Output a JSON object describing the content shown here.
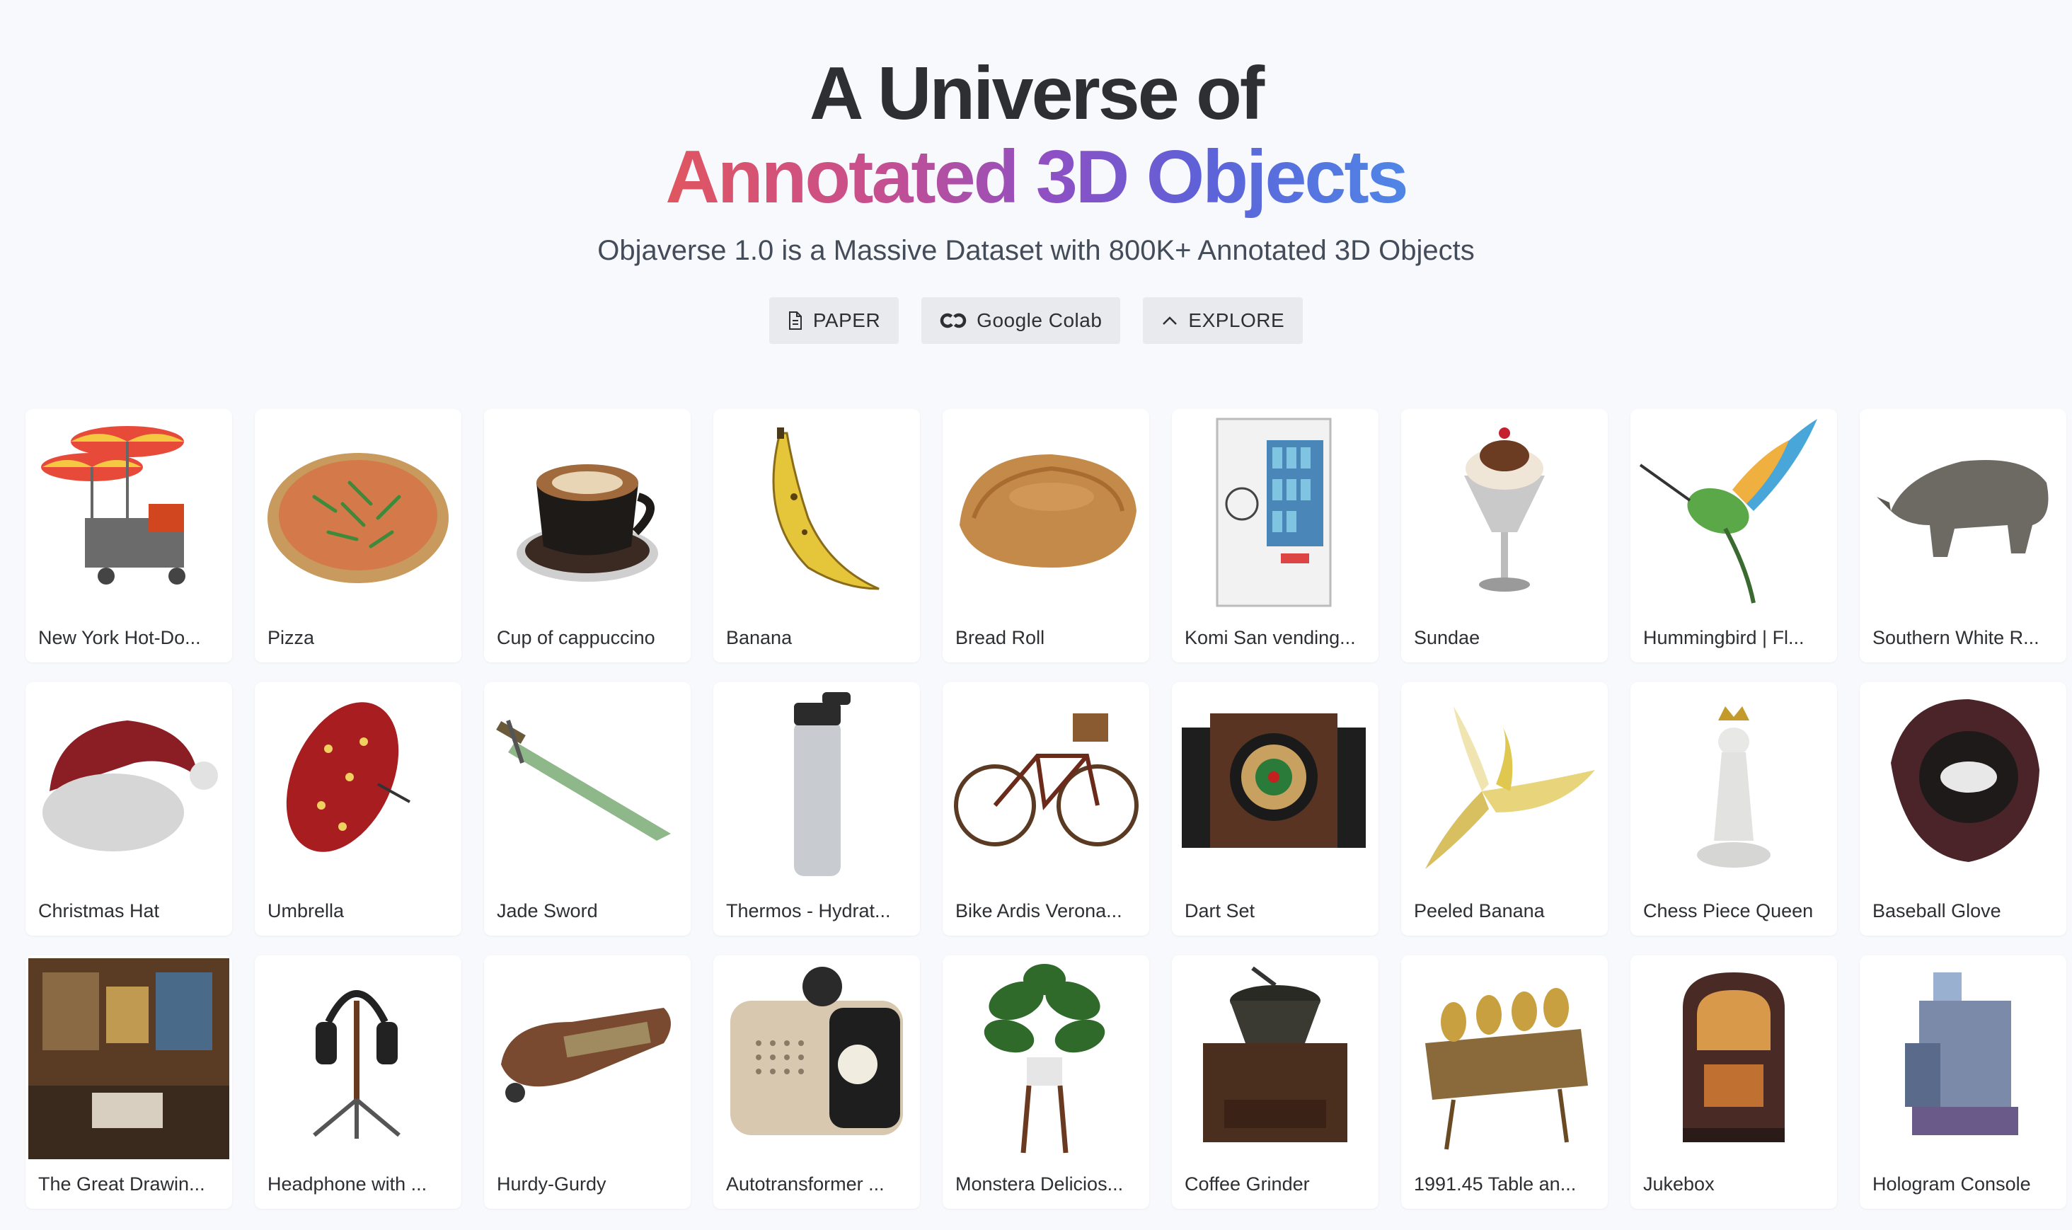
{
  "hero": {
    "title_line1": "A Universe of",
    "title_line2": "Annotated 3D Objects",
    "subtitle": "Objaverse 1.0 is a Massive Dataset with 800K+ Annotated 3D Objects"
  },
  "buttons": [
    {
      "label": "PAPER",
      "icon": "document-icon"
    },
    {
      "label": "Google Colab",
      "icon": "colab-icon"
    },
    {
      "label": "EXPLORE",
      "icon": "chevron-up-icon"
    }
  ],
  "colors": {
    "background": "#f8f9fc",
    "gradient_start": "#e0565f",
    "gradient_mid": "#8e50c4",
    "gradient_end": "#4f86e6",
    "button_bg": "#e8eaee"
  },
  "objects": [
    [
      {
        "label": "New York Hot-Do...",
        "thumb": "hot-dog-cart"
      },
      {
        "label": "Pizza",
        "thumb": "pizza"
      },
      {
        "label": "Cup of cappuccino",
        "thumb": "cappuccino"
      },
      {
        "label": "Banana",
        "thumb": "banana"
      },
      {
        "label": "Bread Roll",
        "thumb": "bread"
      },
      {
        "label": "Komi San vending...",
        "thumb": "vending-machine"
      },
      {
        "label": "Sundae",
        "thumb": "sundae"
      },
      {
        "label": "Hummingbird | Fl...",
        "thumb": "hummingbird"
      },
      {
        "label": "Southern White R...",
        "thumb": "rhino"
      }
    ],
    [
      {
        "label": "Christmas Hat",
        "thumb": "christmas-hat"
      },
      {
        "label": "Umbrella",
        "thumb": "umbrella"
      },
      {
        "label": "Jade Sword",
        "thumb": "sword"
      },
      {
        "label": "Thermos - Hydrat...",
        "thumb": "thermos"
      },
      {
        "label": "Bike Ardis Verona...",
        "thumb": "bike"
      },
      {
        "label": "Dart Set",
        "thumb": "dart-set"
      },
      {
        "label": "Peeled Banana",
        "thumb": "peeled-banana"
      },
      {
        "label": "Chess Piece Queen",
        "thumb": "chess-queen"
      },
      {
        "label": "Baseball Glove",
        "thumb": "baseball-glove"
      }
    ],
    [
      {
        "label": "The Great Drawin...",
        "thumb": "drawing-room"
      },
      {
        "label": "Headphone with ...",
        "thumb": "headphone-stand"
      },
      {
        "label": "Hurdy-Gurdy",
        "thumb": "hurdy-gurdy"
      },
      {
        "label": "Autotransformer ...",
        "thumb": "autotransformer"
      },
      {
        "label": "Monstera Delicios...",
        "thumb": "monstera"
      },
      {
        "label": "Coffee Grinder",
        "thumb": "coffee-grinder"
      },
      {
        "label": "1991.45 Table an...",
        "thumb": "table-ornament"
      },
      {
        "label": "Jukebox",
        "thumb": "jukebox"
      },
      {
        "label": "Hologram Console",
        "thumb": "hologram-console"
      }
    ]
  ]
}
